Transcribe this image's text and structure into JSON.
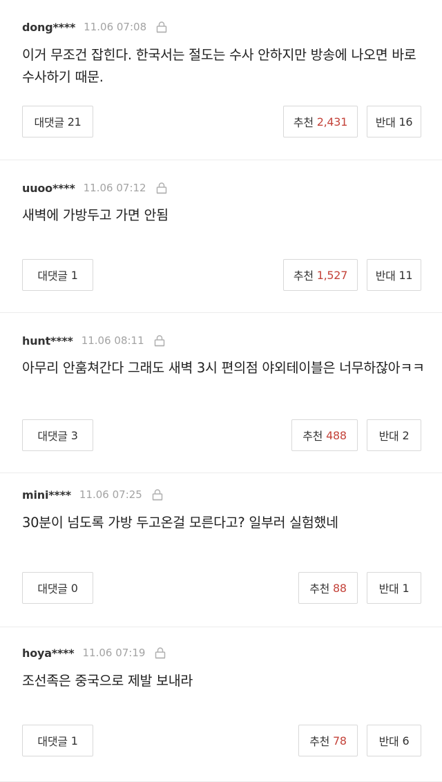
{
  "comments": [
    {
      "author": "dong****",
      "time": "11.06 07:08",
      "text": "이거 무조건 잡힌다. 한국서는 절도는 수사 안하지만 방송에 나오면 바로 수사하기 때문.",
      "reply_label": "대댓글",
      "reply_count": "21",
      "like_label": "추천",
      "like_count": "2,431",
      "dislike_label": "반대",
      "dislike_count": "16"
    },
    {
      "author": "uuoo****",
      "time": "11.06 07:12",
      "text": "새벽에 가방두고 가면 안됨",
      "reply_label": "대댓글",
      "reply_count": "1",
      "like_label": "추천",
      "like_count": "1,527",
      "dislike_label": "반대",
      "dislike_count": "11"
    },
    {
      "author": "hunt****",
      "time": "11.06 08:11",
      "text": "아무리 안훔쳐간다 그래도 새벽 3시 편의점 야외테이블은 너무하잖아ㅋㅋ",
      "reply_label": "대댓글",
      "reply_count": "3",
      "like_label": "추천",
      "like_count": "488",
      "dislike_label": "반대",
      "dislike_count": "2"
    },
    {
      "author": "mini****",
      "time": "11.06 07:25",
      "text": "30분이 넘도록 가방 두고온걸 모른다고? 일부러 실험했네",
      "reply_label": "대댓글",
      "reply_count": "0",
      "like_label": "추천",
      "like_count": "88",
      "dislike_label": "반대",
      "dislike_count": "1"
    },
    {
      "author": "hoya****",
      "time": "11.06 07:19",
      "text": "조선족은 중국으로 제발 보내라",
      "reply_label": "대댓글",
      "reply_count": "1",
      "like_label": "추천",
      "like_count": "78",
      "dislike_label": "반대",
      "dislike_count": "6"
    }
  ],
  "colors": {
    "like_count": "#c4433a",
    "time": "#a3a3a3",
    "border": "#d8d8d8"
  },
  "icons": {
    "report": "lock-icon"
  }
}
